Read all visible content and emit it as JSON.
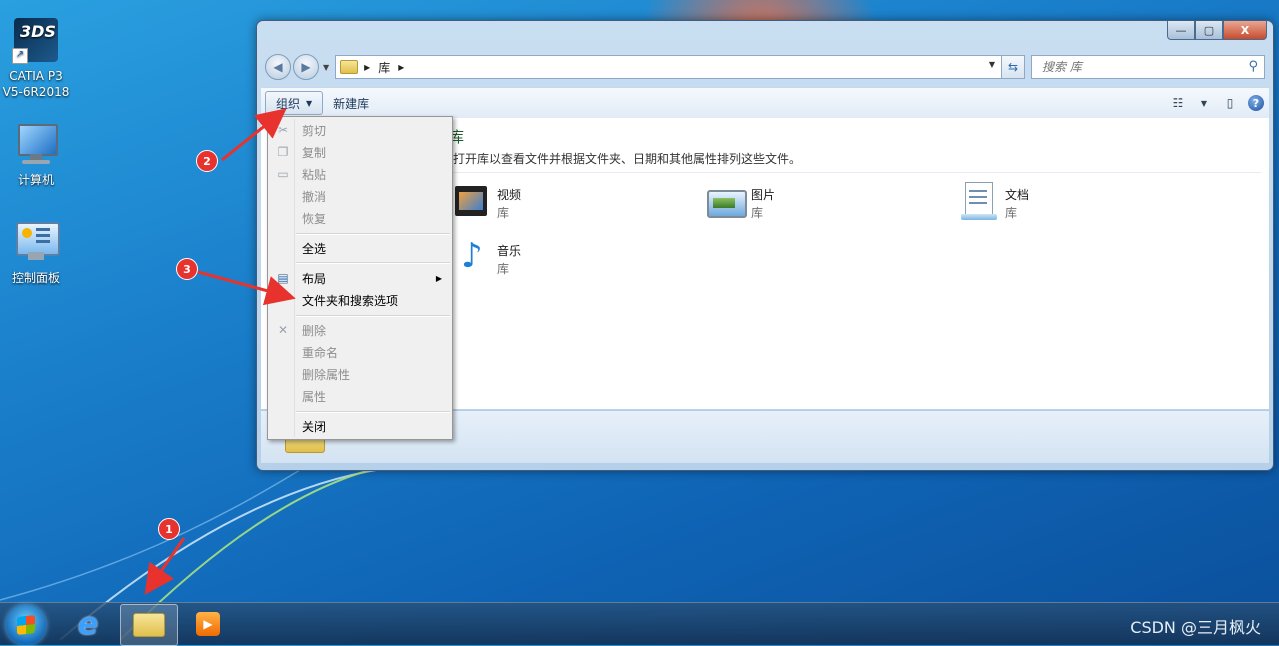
{
  "desktop": {
    "icons": [
      {
        "label": "CATIA P3\nV5-6R2018"
      },
      {
        "label": "计算机"
      },
      {
        "label": "控制面板"
      }
    ]
  },
  "window": {
    "controls": {
      "minimize": "—",
      "maximize": "▢",
      "close": "X"
    },
    "nav": {
      "breadcrumb": [
        "库"
      ],
      "search_placeholder": "搜索 库"
    },
    "toolbar": {
      "organize_label": "组织",
      "new_library_label": "新建库"
    },
    "content": {
      "title": "库",
      "description": "打开库以查看文件并根据文件夹、日期和其他属性排列这些文件。",
      "libraries": [
        {
          "name": "视频",
          "type": "库"
        },
        {
          "name": "图片",
          "type": "库"
        },
        {
          "name": "文档",
          "type": "库"
        },
        {
          "name": "音乐",
          "type": "库"
        }
      ]
    }
  },
  "menu": {
    "items": [
      {
        "label": "剪切",
        "enabled": false,
        "icon": "scissors-icon"
      },
      {
        "label": "复制",
        "enabled": false,
        "icon": "copy-icon"
      },
      {
        "label": "粘贴",
        "enabled": false,
        "icon": "paste-icon"
      },
      {
        "label": "撤消",
        "enabled": false
      },
      {
        "label": "恢复",
        "enabled": false
      },
      {
        "label": "全选",
        "enabled": true
      },
      {
        "label": "布局",
        "enabled": true,
        "icon": "layout-icon",
        "submenu": true
      },
      {
        "label": "文件夹和搜索选项",
        "enabled": true
      },
      {
        "label": "删除",
        "enabled": false,
        "icon": "delete-icon"
      },
      {
        "label": "重命名",
        "enabled": false
      },
      {
        "label": "删除属性",
        "enabled": false
      },
      {
        "label": "属性",
        "enabled": false
      },
      {
        "label": "关闭",
        "enabled": true
      }
    ]
  },
  "annotations": {
    "badges": [
      "1",
      "2",
      "3"
    ],
    "color": "#e8322e"
  },
  "taskbar": {
    "watermark": "CSDN @三月枫火"
  }
}
